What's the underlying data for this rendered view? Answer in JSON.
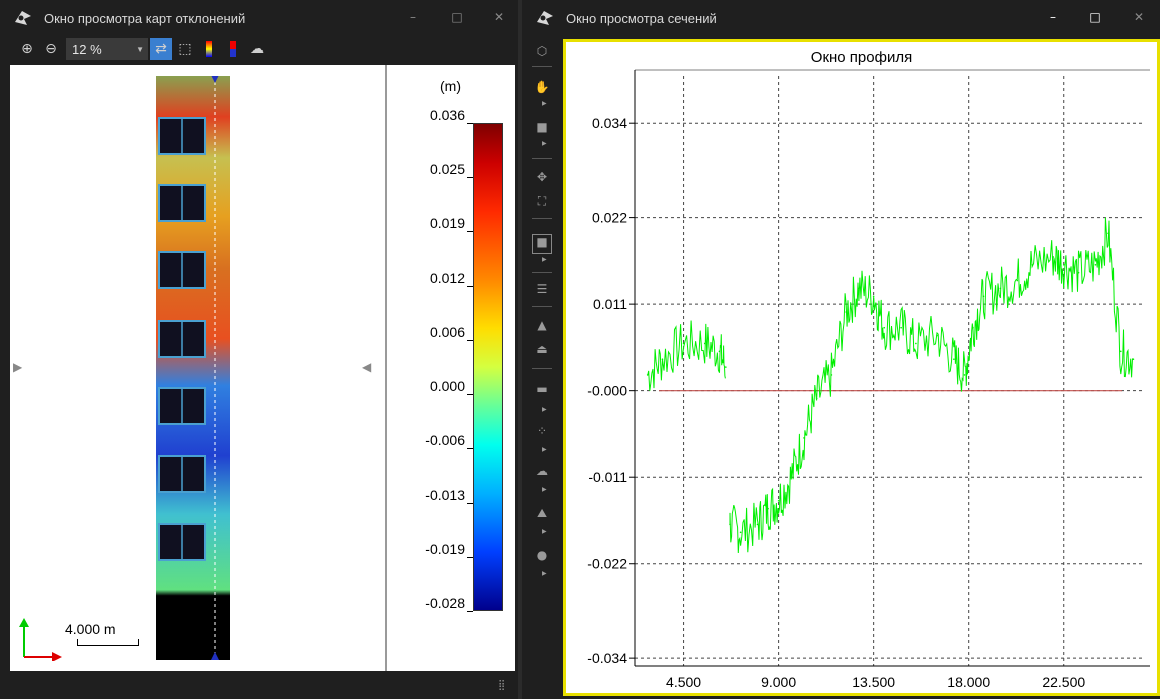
{
  "left_window": {
    "title": "Окно просмотра карт отклонений",
    "controls": {
      "minimize": "–",
      "maximize": "□",
      "close": "✕"
    },
    "toolbar": {
      "zoom_value": "12 %"
    },
    "colorbar": {
      "unit": "(m)",
      "labels": [
        "0.036",
        "0.025",
        "0.019",
        "0.012",
        "0.006",
        "0.000",
        "-0.006",
        "-0.013",
        "-0.019",
        "-0.028"
      ]
    },
    "scale_bar": "4.000 m"
  },
  "right_window": {
    "title": "Окно просмотра сечений",
    "controls": {
      "minimize": "–",
      "maximize": "□",
      "close": "✕"
    },
    "profile_title": "Окно профиля"
  },
  "chart_data": {
    "type": "line",
    "title": "Окно профиля",
    "xlabel": "",
    "ylabel": "",
    "x_ticks": [
      "4.500",
      "9.000",
      "13.500",
      "18.000",
      "22.500"
    ],
    "y_ticks": [
      "0.034",
      "0.022",
      "0.011",
      "-0.000",
      "-0.011",
      "-0.022",
      "-0.034"
    ],
    "xlim": [
      2.2,
      26.3
    ],
    "ylim": [
      -0.035,
      0.04
    ],
    "grid": true,
    "reference_line": {
      "y": 0.0,
      "color": "#c0504d"
    },
    "series": [
      {
        "color": "#00ee00",
        "x": [
          2.8,
          3.5,
          4.5,
          5.5,
          6.2,
          6.5,
          6.7,
          7.2,
          8.0,
          8.5,
          9.0,
          9.6,
          10.2,
          10.8,
          11.5,
          12.2,
          12.8,
          13.5,
          14.0,
          14.8,
          15.5,
          16.5,
          17.3,
          17.8,
          18.2,
          18.7,
          19.5,
          20.3,
          21.0,
          22.0,
          22.5,
          23.2,
          24.0,
          24.6,
          25.2,
          25.8
        ],
        "values": [
          0.002,
          0.004,
          0.006,
          0.006,
          0.005,
          0.003,
          -0.017,
          -0.018,
          -0.017,
          -0.015,
          -0.014,
          -0.011,
          -0.006,
          -0.001,
          0.002,
          0.01,
          0.013,
          0.012,
          0.008,
          0.008,
          0.006,
          0.007,
          0.004,
          0.002,
          0.008,
          0.012,
          0.013,
          0.014,
          0.016,
          0.017,
          0.016,
          0.015,
          0.016,
          0.02,
          0.005,
          0.004
        ]
      }
    ]
  }
}
